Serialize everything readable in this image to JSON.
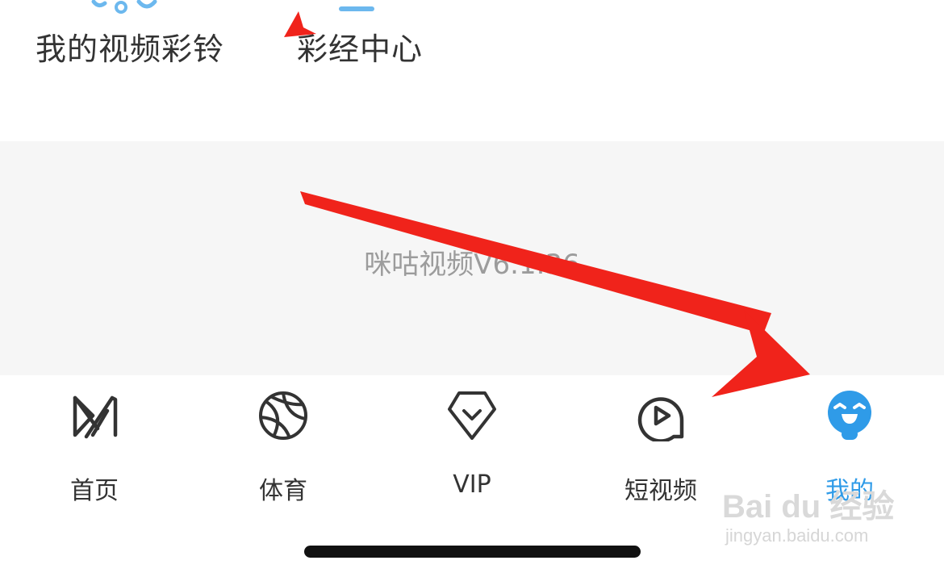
{
  "menu": {
    "items": [
      {
        "label": "我的视频彩铃",
        "icon": "ringtone-icon"
      },
      {
        "label": "彩经中心",
        "icon": "caijing-icon"
      }
    ]
  },
  "footer": {
    "version": "咪咕视频V6.1.36"
  },
  "tabbar": {
    "tabs": [
      {
        "label": "首页",
        "icon": "home-icon",
        "active": false
      },
      {
        "label": "体育",
        "icon": "basketball-icon",
        "active": false
      },
      {
        "label": "VIP",
        "icon": "vip-shield-icon",
        "active": false
      },
      {
        "label": "短视频",
        "icon": "play-circle-icon",
        "active": false
      },
      {
        "label": "我的",
        "icon": "smiley-face-icon",
        "active": true
      }
    ]
  },
  "watermark": {
    "logo": "Bai du 经验",
    "url": "jingyan.baidu.com"
  },
  "colors": {
    "accent": "#2f9be8",
    "annotation_arrow": "#f0231b",
    "text": "#333333",
    "muted": "#9c9c9c"
  }
}
